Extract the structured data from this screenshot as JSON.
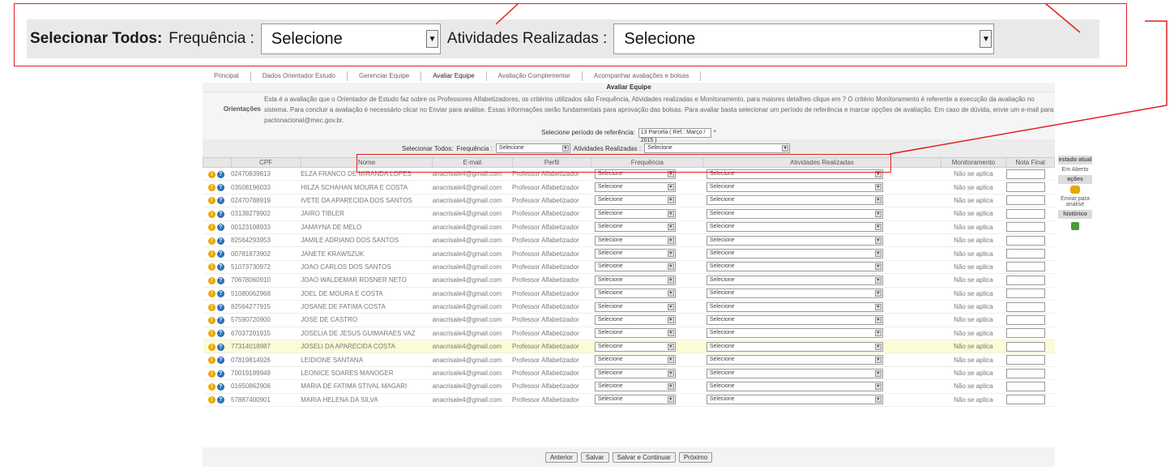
{
  "zoom": {
    "select_all_label": "Selecionar Todos:",
    "freq_label": "Frequência :",
    "freq_value": "Selecione",
    "ativ_label": "Atividades Realizadas :",
    "ativ_value": "Selecione"
  },
  "tabs": [
    "Principal",
    "Dados Orientador Estudo",
    "Gerenciar Equipe",
    "Avaliar Equipe",
    "Avaliação Complementar",
    "Acompanhar avaliações e bolsas"
  ],
  "eval_title": "Avaliar Equipe",
  "guide": {
    "label": "Orientações",
    "text": "Esta é a avaliação que o Orientador de Estudo faz sobre os Professores Alfabetizadores, os critérios utilizados são Frequência, Atividades realizadas e Monitoramento, para maiores detalhes clique em ? O critério Monitoramento é referente a execução da avaliação no sistema. Para concluir a avaliação é necessário clicar no Enviar para análise. Essas informações serão fundamentais para aprovação das bolsas. Para avaliar basta selecionar um período de referência e marcar opções de avaliação. Em caso de dúvida, envie um e-mail para pactonacional@mec.gov.br."
  },
  "period": {
    "label": "Selecione período de referência:",
    "value": "13 Parcela ( Ref.: Março / 2015 )",
    "required": "*"
  },
  "select_all": {
    "label": "Selecionar Todos:",
    "freq_label": "Frequência :",
    "freq_value": "Selecione",
    "ativ_label": "Atividades Realizadas :",
    "ativ_value": "Selecione"
  },
  "columns": [
    "",
    "CPF",
    "Nome",
    "E-mail",
    "Perfil",
    "Frequência",
    "Atividades Realizadas",
    "Monitoramento",
    "Nota Final"
  ],
  "rows": [
    {
      "cpf": "02470839813",
      "nome": "ELZA FRANCO DE MIRANDA LOPES",
      "email": "anacrisale4@gmail.com",
      "perfil": "Professor Alfabetizador",
      "freq": "Selecione",
      "ativ": "Selecione",
      "monit": "Não se aplica"
    },
    {
      "cpf": "03508196033",
      "nome": "HILZA SCHAHAN MOURA E COSTA",
      "email": "anacrisale4@gmail.com",
      "perfil": "Professor Alfabetizador",
      "freq": "Selecione",
      "ativ": "Selecione",
      "monit": "Não se aplica"
    },
    {
      "cpf": "02470788919",
      "nome": "IVETE DA APARECIDA DOS SANTOS",
      "email": "anacrisale4@gmail.com",
      "perfil": "Professor Alfabetizador",
      "freq": "Selecione",
      "ativ": "Selecione",
      "monit": "Não se aplica"
    },
    {
      "cpf": "03138279902",
      "nome": "JAIRO TIBLER",
      "email": "anacrisale4@gmail.com",
      "perfil": "Professor Alfabetizador",
      "freq": "Selecione",
      "ativ": "Selecione",
      "monit": "Não se aplica"
    },
    {
      "cpf": "00123108933",
      "nome": "JAMAYNA DE MELO",
      "email": "anacrisale4@gmail.com",
      "perfil": "Professor Alfabetizador",
      "freq": "Selecione",
      "ativ": "Selecione",
      "monit": "Não se aplica"
    },
    {
      "cpf": "82564293953",
      "nome": "JAMILE ADRIANO DOS SANTOS",
      "email": "anacrisale4@gmail.com",
      "perfil": "Professor Alfabetizador",
      "freq": "Selecione",
      "ativ": "Selecione",
      "monit": "Não se aplica"
    },
    {
      "cpf": "00781873902",
      "nome": "JANETE KRAWSZUK",
      "email": "anacrisale4@gmail.com",
      "perfil": "Professor Alfabetizador",
      "freq": "Selecione",
      "ativ": "Selecione",
      "monit": "Não se aplica"
    },
    {
      "cpf": "51073730972",
      "nome": "JOAO CARLOS DOS SANTOS",
      "email": "anacrisale4@gmail.com",
      "perfil": "Professor Alfabetizador",
      "freq": "Selecione",
      "ativ": "Selecione",
      "monit": "Não se aplica"
    },
    {
      "cpf": "70678060910",
      "nome": "JOAO WALDEMAR ROSNER NETO",
      "email": "anacrisale4@gmail.com",
      "perfil": "Professor Alfabetizador",
      "freq": "Selecione",
      "ativ": "Selecione",
      "monit": "Não se aplica"
    },
    {
      "cpf": "51080062968",
      "nome": "JOEL DE MOURA E COSTA",
      "email": "anacrisale4@gmail.com",
      "perfil": "Professor Alfabetizador",
      "freq": "Selecione",
      "ativ": "Selecione",
      "monit": "Não se aplica"
    },
    {
      "cpf": "82564277915",
      "nome": "JOSANE DE FATIMA COSTA",
      "email": "anacrisale4@gmail.com",
      "perfil": "Professor Alfabetizador",
      "freq": "Selecione",
      "ativ": "Selecione",
      "monit": "Não se aplica"
    },
    {
      "cpf": "57590720900",
      "nome": "JOSE DE CASTRO",
      "email": "anacrisale4@gmail.com",
      "perfil": "Professor Alfabetizador",
      "freq": "Selecione",
      "ativ": "Selecione",
      "monit": "Não se aplica"
    },
    {
      "cpf": "67037201915",
      "nome": "JOSELIA DE JESUS GUIMARAES VAZ",
      "email": "anacrisale4@gmail.com",
      "perfil": "Professor Alfabetizador",
      "freq": "Selecione",
      "ativ": "Selecione",
      "monit": "Não se aplica"
    },
    {
      "cpf": "77314018987",
      "nome": "JOSELI DA APARECIDA COSTA",
      "email": "anacrisale4@gmail.com",
      "perfil": "Professor Alfabetizador",
      "freq": "Selecione",
      "ativ": "Selecione",
      "monit": "Não se aplica",
      "highlight": true
    },
    {
      "cpf": "07819814926",
      "nome": "LEIDIONE SANTANA",
      "email": "anacrisale4@gmail.com",
      "perfil": "Professor Alfabetizador",
      "freq": "Selecione",
      "ativ": "Selecione",
      "monit": "Não se aplica"
    },
    {
      "cpf": "70019189949",
      "nome": "LEONICE SOARES MANOGER",
      "email": "anacrisale4@gmail.com",
      "perfil": "Professor Alfabetizador",
      "freq": "Selecione",
      "ativ": "Selecione",
      "monit": "Não se aplica"
    },
    {
      "cpf": "01650862906",
      "nome": "MARIA DE FATIMA STIVAL MAGARI",
      "email": "anacrisale4@gmail.com",
      "perfil": "Professor Alfabetizador",
      "freq": "Selecione",
      "ativ": "Selecione",
      "monit": "Não se aplica"
    },
    {
      "cpf": "57887400901",
      "nome": "MARIA HELENA DA SILVA",
      "email": "anacrisale4@gmail.com",
      "perfil": "Professor Alfabetizador",
      "freq": "Selecione",
      "ativ": "Selecione",
      "monit": "Não se aplica"
    }
  ],
  "buttons": [
    "Anterior",
    "Salvar",
    "Salvar e Continuar",
    "Próximo"
  ],
  "state_panel": {
    "state_header": "estado atual",
    "state_value": "Em Aberto",
    "actions_header": "ações",
    "send_label": "Enviar para análise",
    "history_header": "histórico"
  },
  "colors": {
    "callout": "#e02020",
    "warn_icon": "#e8a800",
    "help_icon": "#2b6fb6",
    "highlight_row": "#fbfbd6"
  },
  "icons": {
    "warn": "exclamation-circle-icon",
    "help": "question-circle-icon",
    "send": "thumbs-up-icon",
    "history": "history-icon"
  }
}
